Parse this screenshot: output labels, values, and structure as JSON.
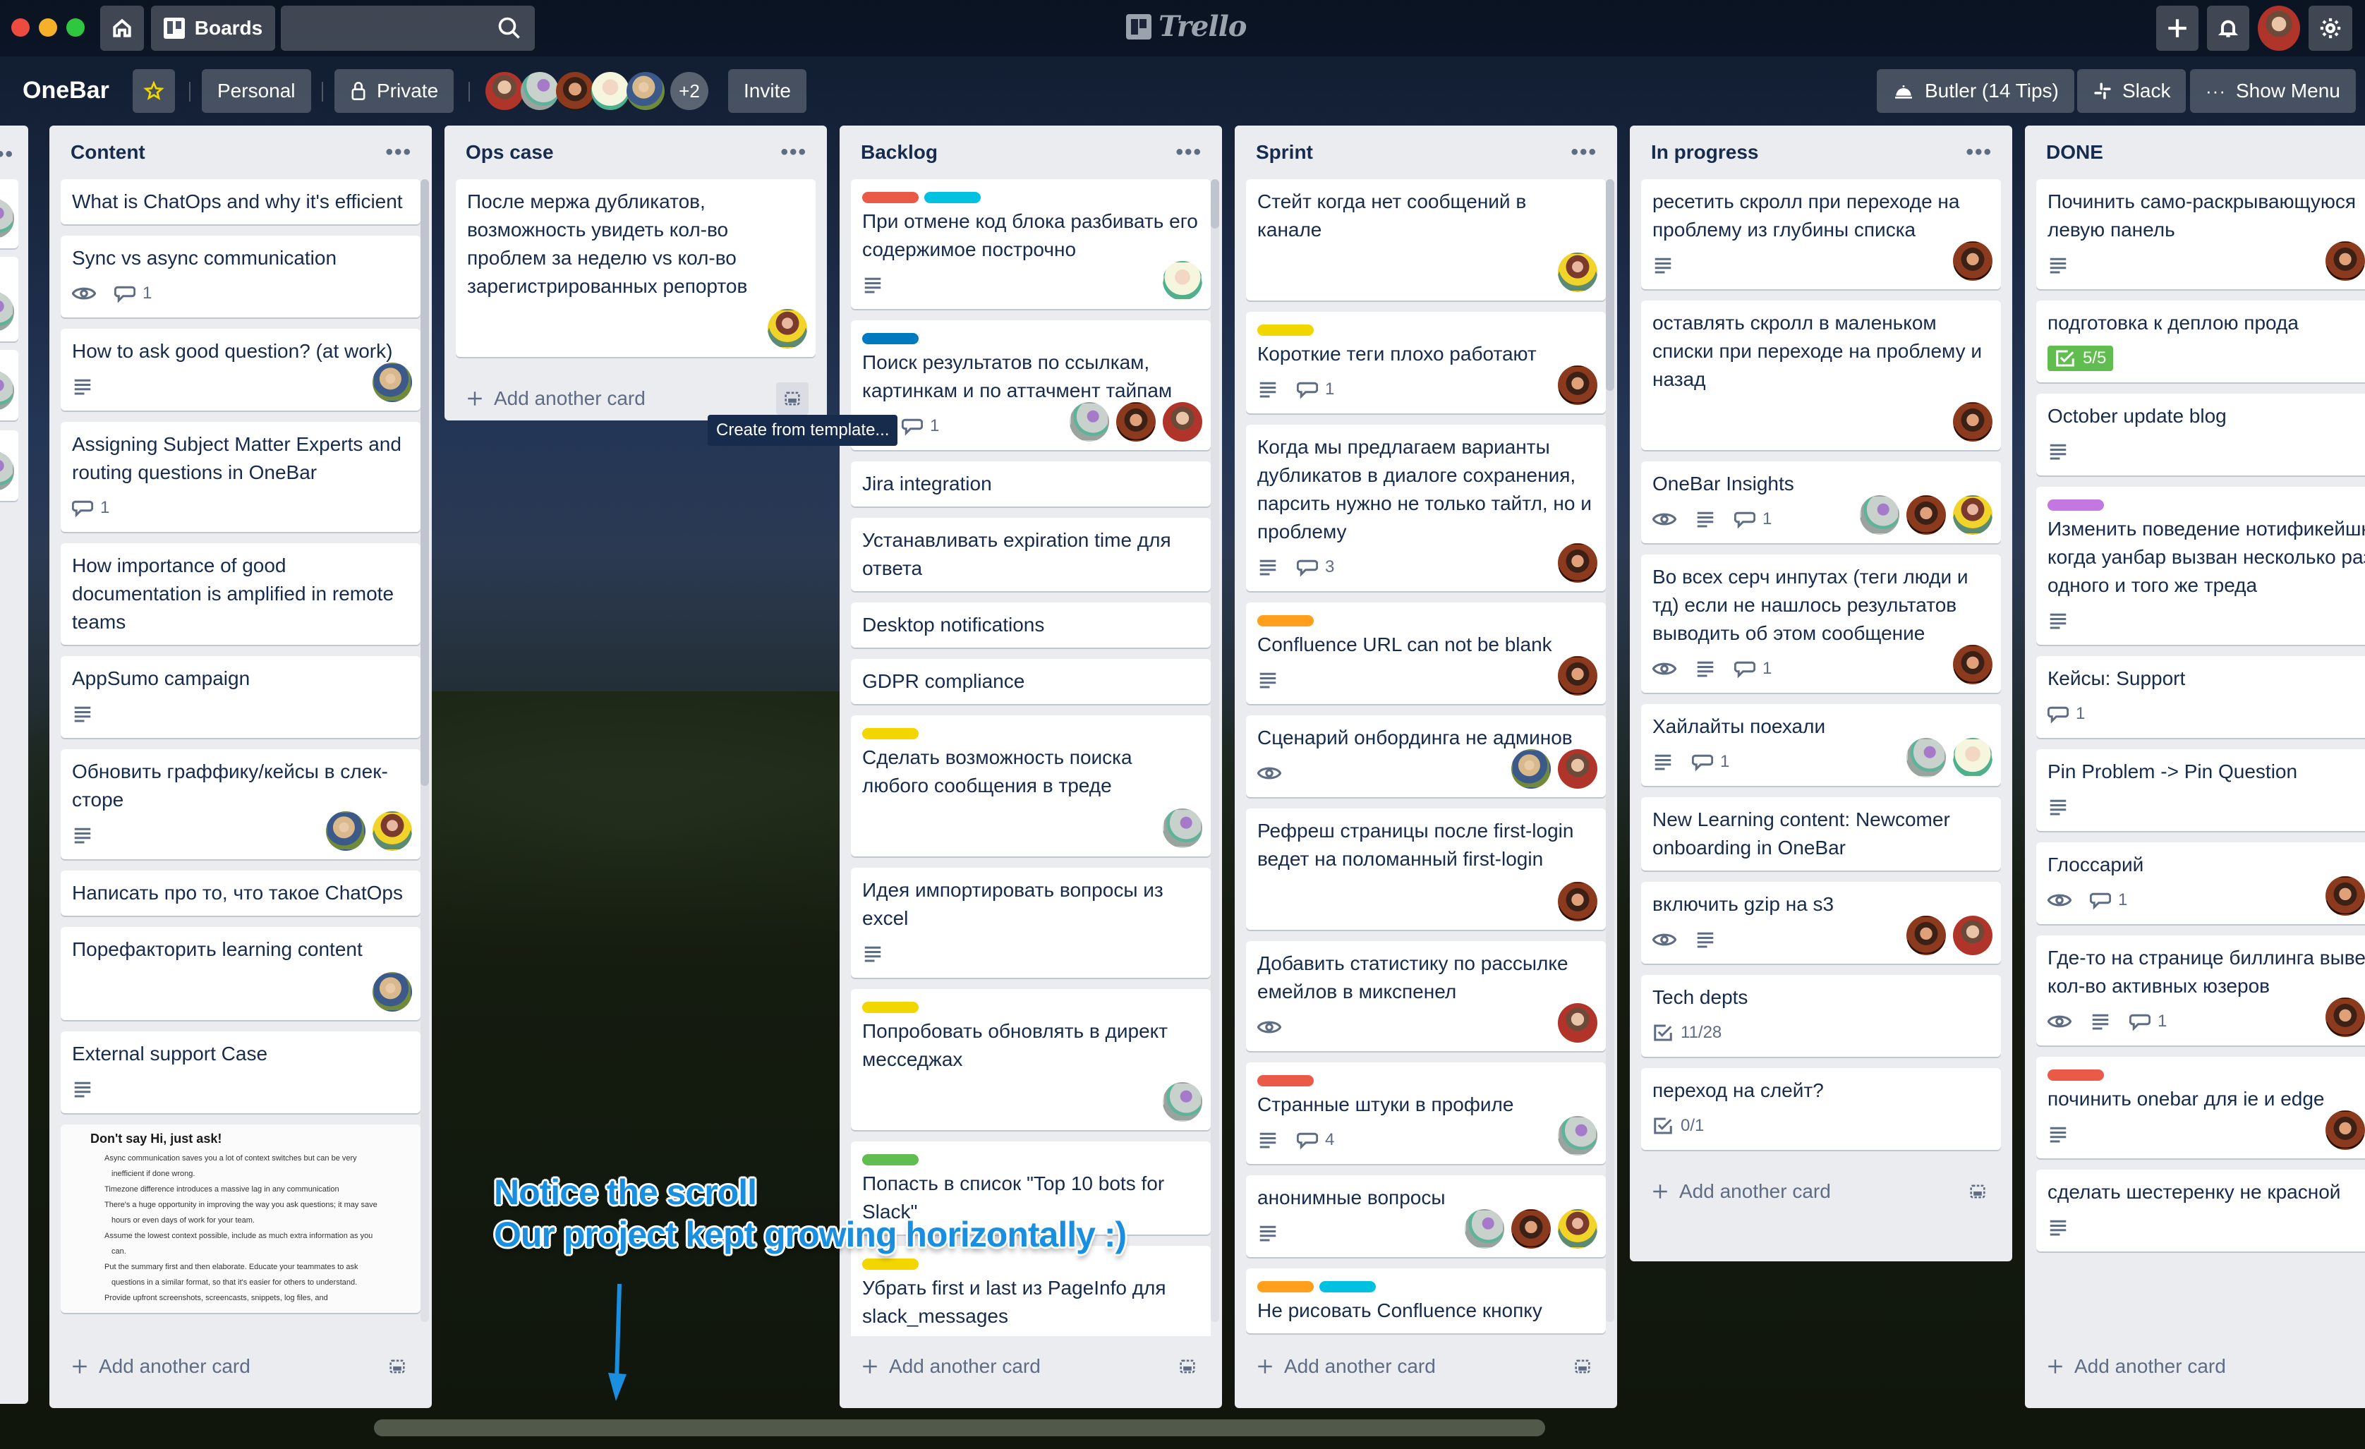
{
  "window": {
    "traffic_lights": [
      "close",
      "minimize",
      "zoom"
    ]
  },
  "topbar": {
    "home_icon": "home-icon",
    "boards_label": "Boards",
    "search_value": "",
    "search_placeholder": "",
    "logo_text": "Trello",
    "right_icons": [
      "plus-icon",
      "bell-icon",
      "avatar",
      "gear-icon"
    ]
  },
  "board_header": {
    "title": "OneBar",
    "starred": true,
    "team_label": "Personal",
    "visibility_label": "Private",
    "members_extra": "+2",
    "invite_label": "Invite",
    "butler_label": "Butler (14 Tips)",
    "slack_label": "Slack",
    "show_menu_label": "Show Menu"
  },
  "colors": {
    "label_red": "#eb5a46",
    "label_sky": "#00c2e0",
    "label_blue": "#0079bf",
    "label_yellow": "#f2d600",
    "label_orange": "#ff9f1a",
    "label_green": "#61bd4f",
    "label_purple": "#c377e0",
    "annotation_blue": "#1a8fe0"
  },
  "common": {
    "add_card_label": "Add another card",
    "list_menu": "•••"
  },
  "tooltip": "Create from template...",
  "annotation": {
    "line1": "Notice the scroll",
    "line2": "Our project kept growing horizontally :)"
  },
  "lists": [
    {
      "title": "Content",
      "cards": [
        {
          "title": "What is ChatOps and why it's efficient",
          "labels": [],
          "badges": [],
          "members": []
        },
        {
          "title": "Sync vs async communication",
          "labels": [],
          "badges": [
            {
              "type": "watch"
            },
            {
              "type": "comments",
              "value": "1"
            }
          ],
          "members": []
        },
        {
          "title": "How to ask good question? (at work)",
          "labels": [],
          "badges": [
            {
              "type": "description"
            }
          ],
          "members": [
            "e"
          ]
        },
        {
          "title": "Assigning Subject Matter Experts and routing questions in OneBar",
          "labels": [],
          "badges": [
            {
              "type": "comments",
              "value": "1"
            }
          ],
          "members": []
        },
        {
          "title": "How importance of good documentation is amplified in remote teams",
          "labels": [],
          "badges": [],
          "members": []
        },
        {
          "title": "AppSumo campaign",
          "labels": [],
          "badges": [
            {
              "type": "description"
            }
          ],
          "members": []
        },
        {
          "title": "Обновить граффику/кейсы в слек-сторе",
          "labels": [],
          "badges": [
            {
              "type": "description"
            }
          ],
          "members": [
            "e",
            "f"
          ]
        },
        {
          "title": "Написать про то, что такое ChatOps",
          "labels": [],
          "badges": [],
          "members": []
        },
        {
          "title": "Порефакторить learning content",
          "labels": [],
          "badges": [],
          "members": [
            "e"
          ]
        },
        {
          "title": "External support Case",
          "labels": [],
          "badges": [
            {
              "type": "description"
            }
          ],
          "members": []
        }
      ],
      "cover_card": {
        "heading": "Don't say Hi, just ask!",
        "bullets": [
          "Async communication saves you a lot of context switches but can be very inefficient if done wrong.",
          "Timezone difference introduces a massive lag in any communication",
          "There's a huge opportunity in improving the way you ask questions; it may save hours or even days of work for your team.",
          "Assume the lowest context possible, include as much extra information as you can.",
          "Put the summary first and then elaborate. Educate your teammates to ask questions in a similar format, so that it's easier for others to understand.",
          "Provide upfront screenshots, screencasts, snippets, log files, and"
        ]
      }
    },
    {
      "title": "Ops case",
      "cards": [
        {
          "title": "После мержа дубликатов, возможность увидеть кол-во проблем за неделю vs кол-во зарегистрированных репортов",
          "labels": [],
          "badges": [],
          "members": [
            "f"
          ]
        }
      ]
    },
    {
      "title": "Backlog",
      "cards": [
        {
          "title": "При отмене код блока разбивать его содержимое построчно",
          "labels": [
            "red",
            "sky"
          ],
          "badges": [
            {
              "type": "description"
            }
          ],
          "members": [
            "d"
          ]
        },
        {
          "title": "Поиск результатов по ссылкам, картинкам и по аттачмент тайпам",
          "labels": [
            "blue"
          ],
          "badges": [
            {
              "type": "description"
            },
            {
              "type": "comments",
              "value": "1"
            }
          ],
          "members": [
            "b",
            "c",
            "a"
          ]
        },
        {
          "title": "Jira integration",
          "labels": [],
          "badges": [],
          "members": []
        },
        {
          "title": "Устанавливать expiration time для ответа",
          "labels": [],
          "badges": [],
          "members": []
        },
        {
          "title": "Desktop notifications",
          "labels": [],
          "badges": [],
          "members": []
        },
        {
          "title": "GDPR compliance",
          "labels": [],
          "badges": [],
          "members": []
        },
        {
          "title": "Сделать возможность поиска любого сообщения в треде",
          "labels": [
            "yellow"
          ],
          "badges": [],
          "members": [
            "b"
          ]
        },
        {
          "title": "Идея импортировать вопросы из excel",
          "labels": [],
          "badges": [
            {
              "type": "description"
            }
          ],
          "members": []
        },
        {
          "title": "Попробовать обновлять в директ месседжах",
          "labels": [
            "yellow"
          ],
          "badges": [],
          "members": [
            "b"
          ]
        },
        {
          "title": "Попасть в список \"Top 10 bots for Slack\"",
          "labels": [
            "green"
          ],
          "badges": [],
          "members": []
        },
        {
          "title": "Убрать first и last из PageInfo для slack_messages",
          "labels": [
            "yellow"
          ],
          "badges": [],
          "members": [
            "b"
          ]
        }
      ]
    },
    {
      "title": "Sprint",
      "cards": [
        {
          "title": "Стейт когда нет сообщений в канале",
          "labels": [],
          "badges": [],
          "members": [
            "f"
          ]
        },
        {
          "title": "Короткие теги плохо работают",
          "labels": [
            "yellow"
          ],
          "badges": [
            {
              "type": "description"
            },
            {
              "type": "comments",
              "value": "1"
            }
          ],
          "members": [
            "c"
          ]
        },
        {
          "title": "Когда мы предлагаем варианты дубликатов в диалоге сохранения, парсить нужно не только тайтл, но и проблему",
          "labels": [],
          "badges": [
            {
              "type": "description"
            },
            {
              "type": "comments",
              "value": "3"
            }
          ],
          "members": [
            "c"
          ]
        },
        {
          "title": "Confluence URL can not be blank",
          "labels": [
            "orange"
          ],
          "badges": [
            {
              "type": "description"
            }
          ],
          "members": [
            "c"
          ]
        },
        {
          "title": "Сценарий онбординга не админов",
          "labels": [],
          "badges": [
            {
              "type": "watch"
            }
          ],
          "members": [
            "e",
            "a"
          ]
        },
        {
          "title": "Рефреш страницы после first-login ведет на поломанный first-login",
          "labels": [],
          "badges": [],
          "members": [
            "c"
          ]
        },
        {
          "title": "Добавить статистику по рассылке емейлов в микспенел",
          "labels": [],
          "badges": [
            {
              "type": "watch"
            }
          ],
          "members": [
            "a"
          ]
        },
        {
          "title": "Странные штуки в профиле",
          "labels": [
            "red"
          ],
          "badges": [
            {
              "type": "description"
            },
            {
              "type": "comments",
              "value": "4"
            }
          ],
          "members": [
            "b"
          ]
        },
        {
          "title": "анонимные вопросы",
          "labels": [],
          "badges": [
            {
              "type": "description"
            }
          ],
          "members": [
            "b",
            "c",
            "f"
          ]
        },
        {
          "title": "Не рисовать Confluence кнопку",
          "labels": [
            "orange",
            "sky"
          ],
          "badges": [],
          "members": []
        }
      ]
    },
    {
      "title": "In progress",
      "cards": [
        {
          "title": "ресетить скролл при переходе на проблему из глубины списка",
          "labels": [],
          "badges": [
            {
              "type": "description"
            }
          ],
          "members": [
            "c"
          ]
        },
        {
          "title": "оставлять скролл в маленьком списки при переходе на проблему и назад",
          "labels": [],
          "badges": [],
          "members": [
            "c"
          ]
        },
        {
          "title": "OneBar Insights",
          "labels": [],
          "badges": [
            {
              "type": "watch"
            },
            {
              "type": "description"
            },
            {
              "type": "comments",
              "value": "1"
            }
          ],
          "members": [
            "b",
            "c",
            "f"
          ]
        },
        {
          "title": "Во всех серч инпутах (теги люди и тд) если не нашлось результатов выводить об этом сообщение",
          "labels": [],
          "badges": [
            {
              "type": "watch"
            },
            {
              "type": "description"
            },
            {
              "type": "comments",
              "value": "1"
            }
          ],
          "members": [
            "c"
          ]
        },
        {
          "title": "Хайлайты поехали",
          "labels": [],
          "badges": [
            {
              "type": "description"
            },
            {
              "type": "comments",
              "value": "1"
            }
          ],
          "members": [
            "b",
            "d"
          ]
        },
        {
          "title": "New Learning content: Newcomer onboarding in OneBar",
          "labels": [],
          "badges": [],
          "members": []
        },
        {
          "title": "включить gzip на s3",
          "labels": [],
          "badges": [
            {
              "type": "watch"
            },
            {
              "type": "description"
            }
          ],
          "members": [
            "c",
            "a"
          ]
        },
        {
          "title": "Tech depts",
          "labels": [],
          "badges": [
            {
              "type": "checklist",
              "value": "11/28",
              "complete": false
            }
          ],
          "members": []
        },
        {
          "title": "переход на слейт?",
          "labels": [],
          "badges": [
            {
              "type": "checklist",
              "value": "0/1",
              "complete": false
            }
          ],
          "members": []
        }
      ]
    },
    {
      "title": "DONE",
      "cards": [
        {
          "title": "Починить само-раскрывающуюся левую панель",
          "labels": [],
          "badges": [
            {
              "type": "description"
            }
          ],
          "members": [
            "c",
            "d"
          ]
        },
        {
          "title": "подготовка к деплою прода",
          "labels": [],
          "badges": [
            {
              "type": "checklist",
              "value": "5/5",
              "complete": true
            }
          ],
          "members": []
        },
        {
          "title": "October update blog",
          "labels": [],
          "badges": [
            {
              "type": "description"
            }
          ],
          "members": [
            "e"
          ]
        },
        {
          "title": "Изменить поведение нотификейшнов, когда уанбар вызван несколько раз из одного и того же треда",
          "labels": [
            "purple"
          ],
          "badges": [
            {
              "type": "description"
            }
          ],
          "members": [
            "b"
          ]
        },
        {
          "title": "Кейсы: Support",
          "labels": [],
          "badges": [
            {
              "type": "comments",
              "value": "1"
            }
          ],
          "members": []
        },
        {
          "title": "Pin Problem -> Pin Question",
          "labels": [],
          "badges": [
            {
              "type": "description"
            }
          ],
          "members": [
            "d"
          ]
        },
        {
          "title": "Глоссарий",
          "labels": [],
          "badges": [
            {
              "type": "watch"
            },
            {
              "type": "comments",
              "value": "1"
            }
          ],
          "members": [
            "c",
            "d"
          ]
        },
        {
          "title": "Где-то на странице биллинга вывести кол-во активных юзеров",
          "labels": [],
          "badges": [
            {
              "type": "watch"
            },
            {
              "type": "description"
            },
            {
              "type": "comments",
              "value": "1"
            }
          ],
          "members": [
            "c",
            "d"
          ]
        },
        {
          "title": "починить onebar для ie и edge",
          "labels": [
            "red"
          ],
          "badges": [
            {
              "type": "description"
            }
          ],
          "members": [
            "c",
            "d"
          ]
        },
        {
          "title": "сделать шестеренку не красной",
          "labels": [],
          "badges": [
            {
              "type": "description"
            }
          ],
          "members": [
            "d"
          ]
        }
      ]
    }
  ]
}
